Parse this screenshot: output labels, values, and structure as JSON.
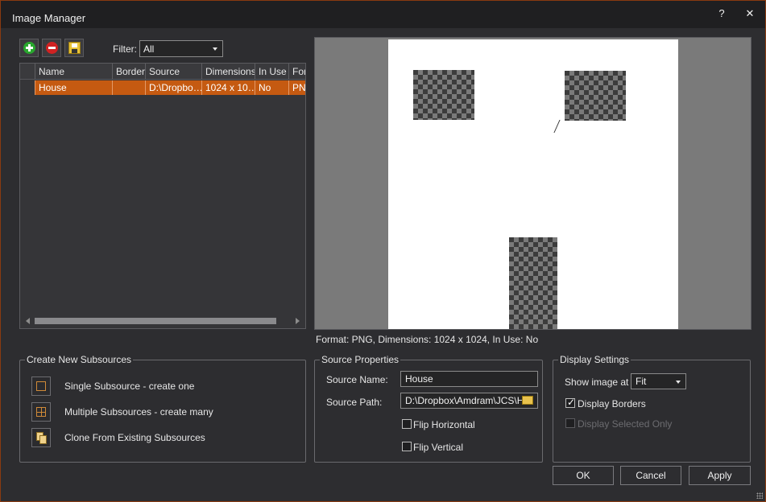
{
  "window": {
    "title": "Image Manager",
    "help_label": "?",
    "close_label": "✕"
  },
  "toolbar": {
    "add_icon": "add-icon",
    "remove_icon": "remove-icon",
    "save_icon": "save-icon",
    "filter_label": "Filter:",
    "filter_value": "All"
  },
  "list": {
    "columns": [
      "Name",
      "Border",
      "Source",
      "Dimensions",
      "In Use",
      "For"
    ],
    "rows": [
      {
        "name": "House",
        "border": "",
        "source": "D:\\Dropbo…",
        "dimensions": "1024 x 10…",
        "in_use": "No",
        "format": "PNG"
      }
    ]
  },
  "preview": {
    "info": "Format: PNG, Dimensions: 1024 x 1024, In Use: No"
  },
  "create_subsources": {
    "title": "Create New Subsources",
    "items": [
      {
        "label": "Single Subsource - create one",
        "icon": "single-subsource-icon"
      },
      {
        "label": "Multiple Subsources - create many",
        "icon": "multiple-subsources-icon"
      },
      {
        "label": "Clone From Existing Subsources",
        "icon": "clone-icon"
      }
    ]
  },
  "source_properties": {
    "title": "Source Properties",
    "name_label": "Source Name:",
    "name_value": "House",
    "path_label": "Source Path:",
    "path_value": "D:\\Dropbox\\Amdram\\JCS\\Ho",
    "flip_h_label": "Flip Horizontal",
    "flip_h_checked": false,
    "flip_v_label": "Flip Vertical",
    "flip_v_checked": false
  },
  "display_settings": {
    "title": "Display Settings",
    "show_label": "Show image at",
    "show_value": "Fit",
    "borders_label": "Display Borders",
    "borders_checked": true,
    "selected_only_label": "Display Selected Only",
    "selected_only_checked": false,
    "selected_only_enabled": false
  },
  "buttons": {
    "ok": "OK",
    "cancel": "Cancel",
    "apply": "Apply"
  }
}
